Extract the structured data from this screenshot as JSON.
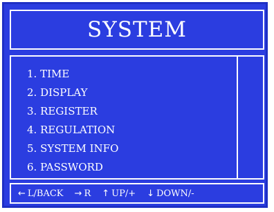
{
  "title": "SYSTEM",
  "menu": {
    "items": [
      {
        "label": "1. TIME"
      },
      {
        "label": "2. DISPLAY"
      },
      {
        "label": "3. REGISTER"
      },
      {
        "label": "4. REGULATION"
      },
      {
        "label": "5. SYSTEM INFO"
      },
      {
        "label": "6. PASSWORD"
      }
    ]
  },
  "nav": {
    "left": {
      "icon": "left-arrow-icon",
      "glyph": "←",
      "label": "L/BACK"
    },
    "right": {
      "icon": "right-arrow-icon",
      "glyph": "→",
      "label": "R"
    },
    "up": {
      "icon": "up-arrow-icon",
      "glyph": "↑",
      "label": "UP/+"
    },
    "down": {
      "icon": "down-arrow-icon",
      "glyph": "↓",
      "label": "DOWN/-"
    }
  },
  "colors": {
    "background": "#2b3de0",
    "border": "#ffffff",
    "text": "#ffffff"
  }
}
